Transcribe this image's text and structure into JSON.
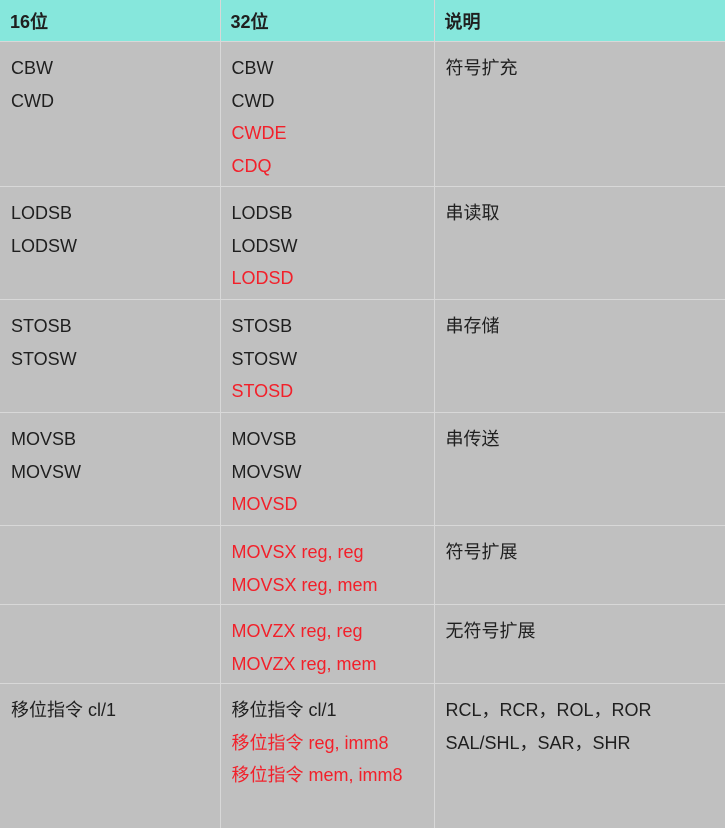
{
  "headers": [
    "16位",
    "32位",
    "说明"
  ],
  "rows": [
    {
      "col16": [
        "CBW",
        "CWD"
      ],
      "col32": [
        {
          "text": "CBW",
          "red": false
        },
        {
          "text": "CWD",
          "red": false
        },
        {
          "text": "CWDE",
          "red": true
        },
        {
          "text": "CDQ",
          "red": true
        }
      ],
      "desc": [
        "符号扩充"
      ]
    },
    {
      "col16": [
        "LODSB",
        "LODSW"
      ],
      "col32": [
        {
          "text": "LODSB",
          "red": false
        },
        {
          "text": "LODSW",
          "red": false
        },
        {
          "text": "LODSD",
          "red": true
        }
      ],
      "desc": [
        "串读取"
      ]
    },
    {
      "col16": [
        "STOSB",
        "STOSW"
      ],
      "col32": [
        {
          "text": "STOSB",
          "red": false
        },
        {
          "text": "STOSW",
          "red": false
        },
        {
          "text": "STOSD",
          "red": true
        }
      ],
      "desc": [
        "串存储"
      ]
    },
    {
      "col16": [
        "MOVSB",
        "MOVSW"
      ],
      "col32": [
        {
          "text": "MOVSB",
          "red": false
        },
        {
          "text": "MOVSW",
          "red": false
        },
        {
          "text": "MOVSD",
          "red": true
        }
      ],
      "desc": [
        "串传送"
      ]
    },
    {
      "col16": [],
      "col32": [
        {
          "text": "MOVSX reg, reg",
          "red": true
        },
        {
          "text": "MOVSX reg, mem",
          "red": true
        }
      ],
      "desc": [
        "符号扩展"
      ]
    },
    {
      "col16": [],
      "col32": [
        {
          "text": "MOVZX reg, reg",
          "red": true
        },
        {
          "text": "MOVZX reg, mem",
          "red": true
        }
      ],
      "desc": [
        "无符号扩展"
      ]
    },
    {
      "col16": [
        "移位指令 cl/1"
      ],
      "col32": [
        {
          "text": "移位指令 cl/1",
          "red": false
        },
        {
          "text": "移位指令 reg, imm8",
          "red": true
        },
        {
          "text": "移位指令 mem, imm8",
          "red": true
        }
      ],
      "desc": [
        "RCL，RCR，ROL，ROR",
        "SAL/SHL，SAR，SHR"
      ]
    }
  ],
  "colors": {
    "header_bg": "#86e7dc",
    "body_bg": "#c0c0c0",
    "highlight_text": "#f2202a",
    "text": "#1f1f1f"
  }
}
